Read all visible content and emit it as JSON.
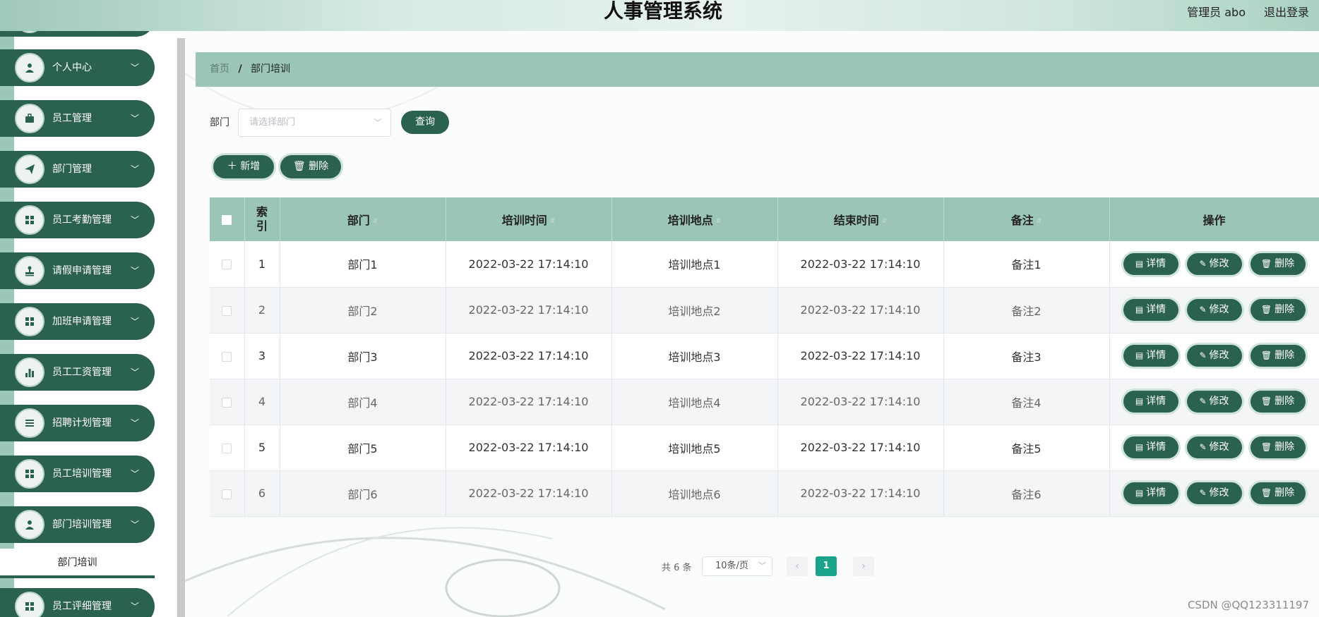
{
  "header": {
    "title": "人事管理系统",
    "user": "管理员 abo",
    "logout": "退出登录"
  },
  "sidebar": {
    "items": [
      {
        "label": "个人中心",
        "icon": "user-icon"
      },
      {
        "label": "员工管理",
        "icon": "briefcase-icon"
      },
      {
        "label": "部门管理",
        "icon": "paper-plane-icon"
      },
      {
        "label": "员工考勤管理",
        "icon": "grid-icon"
      },
      {
        "label": "请假申请管理",
        "icon": "stamp-icon"
      },
      {
        "label": "加班申请管理",
        "icon": "grid-icon"
      },
      {
        "label": "员工工资管理",
        "icon": "bar-chart-icon"
      },
      {
        "label": "招聘计划管理",
        "icon": "list-icon"
      },
      {
        "label": "员工培训管理",
        "icon": "grid-icon"
      },
      {
        "label": "部门培训管理",
        "icon": "user-icon"
      },
      {
        "label": "员工评细管理",
        "icon": "grid-icon"
      }
    ],
    "active_sub": "部门培训"
  },
  "breadcrumb": {
    "home": "首页",
    "separator": "/",
    "current": "部门培训"
  },
  "filter": {
    "label": "部门",
    "placeholder": "请选择部门",
    "query_button": "查询"
  },
  "actions": {
    "add": "新增",
    "delete": "删除"
  },
  "table": {
    "columns": {
      "index": "索引",
      "dept": "部门",
      "train_time": "培训时间",
      "place": "培训地点",
      "end_time": "结束时间",
      "remark": "备注",
      "ops": "操作"
    },
    "rows": [
      {
        "index": "1",
        "dept": "部门1",
        "train_time": "2022-03-22 17:14:10",
        "place": "培训地点1",
        "end_time": "2022-03-22 17:14:10",
        "remark": "备注1"
      },
      {
        "index": "2",
        "dept": "部门2",
        "train_time": "2022-03-22 17:14:10",
        "place": "培训地点2",
        "end_time": "2022-03-22 17:14:10",
        "remark": "备注2"
      },
      {
        "index": "3",
        "dept": "部门3",
        "train_time": "2022-03-22 17:14:10",
        "place": "培训地点3",
        "end_time": "2022-03-22 17:14:10",
        "remark": "备注3"
      },
      {
        "index": "4",
        "dept": "部门4",
        "train_time": "2022-03-22 17:14:10",
        "place": "培训地点4",
        "end_time": "2022-03-22 17:14:10",
        "remark": "备注4"
      },
      {
        "index": "5",
        "dept": "部门5",
        "train_time": "2022-03-22 17:14:10",
        "place": "培训地点5",
        "end_time": "2022-03-22 17:14:10",
        "remark": "备注5"
      },
      {
        "index": "6",
        "dept": "部门6",
        "train_time": "2022-03-22 17:14:10",
        "place": "培训地点6",
        "end_time": "2022-03-22 17:14:10",
        "remark": "备注6"
      }
    ],
    "row_actions": {
      "detail": "详情",
      "edit": "修改",
      "delete": "删除"
    }
  },
  "pagination": {
    "total": "共 6 条",
    "page_size": "10条/页",
    "current_page": "1"
  },
  "watermark": "CSDN @QQ123311197",
  "colors": {
    "primary": "#2b6150",
    "header_bg": "#9bc6b6",
    "page_active": "#19a38a"
  }
}
